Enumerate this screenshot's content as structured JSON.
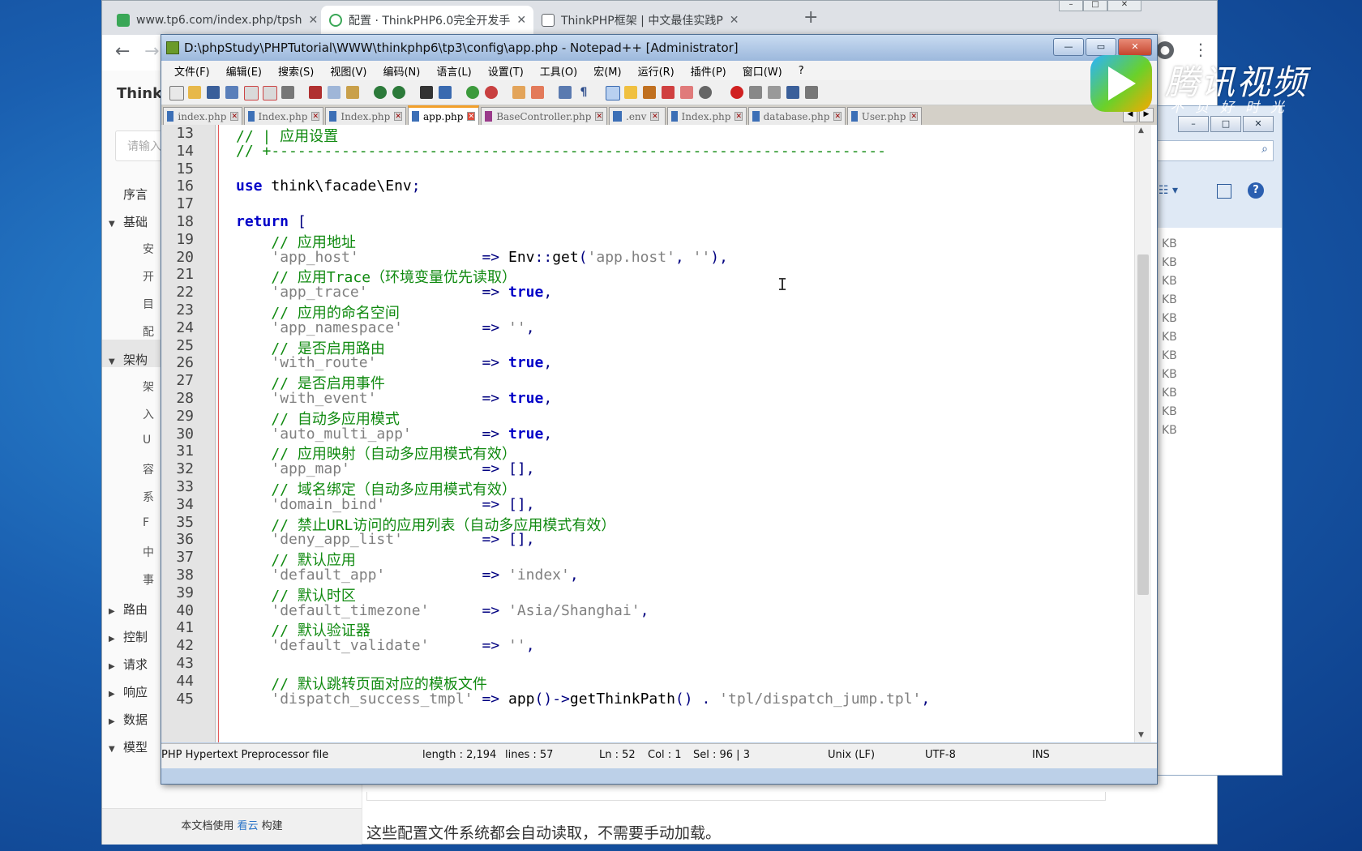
{
  "browser": {
    "tabs": [
      {
        "label": "www.tp6.com/index.php/tpsh",
        "active": false
      },
      {
        "label": "配置 · ThinkPHP6.0完全开发手",
        "active": true
      },
      {
        "label": "ThinkPHP框架 | 中文最佳实践P",
        "active": false
      }
    ],
    "new_tab": "+",
    "back": "←",
    "forward": "→"
  },
  "doc": {
    "brand": "ThinkP",
    "search_placeholder": "请输入",
    "nav": [
      {
        "label": "序言",
        "expandable": false
      },
      {
        "label": "基础",
        "expandable": true,
        "open": true
      },
      {
        "label": "架构",
        "expandable": true,
        "open": true
      },
      {
        "label": "路由",
        "expandable": true,
        "open": false
      },
      {
        "label": "控制",
        "expandable": true,
        "open": false
      },
      {
        "label": "请求",
        "expandable": true,
        "open": false
      },
      {
        "label": "响应",
        "expandable": true,
        "open": false
      },
      {
        "label": "数据",
        "expandable": true,
        "open": false
      },
      {
        "label": "模型",
        "expandable": true,
        "open": true
      }
    ],
    "sub_basic": [
      "安",
      "开",
      "目",
      "配"
    ],
    "sub_arch": [
      "架",
      "入",
      "U",
      "容",
      "系",
      "F",
      "中",
      "事"
    ],
    "footer_prefix": "本文档使用",
    "footer_link": "看云",
    "footer_suffix": "构建",
    "paragraph": "这些配置文件系统都会自动读取，不需要手动加载。"
  },
  "explorer": {
    "sizes": [
      "KB",
      "KB",
      "KB",
      "KB",
      "KB",
      "KB",
      "KB",
      "KB",
      "KB",
      "KB",
      "KB"
    ]
  },
  "npp": {
    "title": "D:\\phpStudy\\PHPTutorial\\WWW\\thinkphp6\\tp3\\config\\app.php - Notepad++ [Administrator]",
    "menu": [
      "文件(F)",
      "编辑(E)",
      "搜索(S)",
      "视图(V)",
      "编码(N)",
      "语言(L)",
      "设置(T)",
      "工具(O)",
      "宏(M)",
      "运行(R)",
      "插件(P)",
      "窗口(W)",
      "?"
    ],
    "tabs": [
      {
        "label": "index.php",
        "active": false
      },
      {
        "label": "Index.php",
        "active": false
      },
      {
        "label": "Index.php",
        "active": false
      },
      {
        "label": "app.php",
        "active": true
      },
      {
        "label": "BaseController.php",
        "active": false
      },
      {
        "label": ".env",
        "active": false
      },
      {
        "label": "Index.php",
        "active": false
      },
      {
        "label": "database.php",
        "active": false
      },
      {
        "label": "User.php",
        "active": false
      }
    ],
    "line_numbers": [
      "13",
      "14",
      "15",
      "16",
      "17",
      "18",
      "19",
      "20",
      "21",
      "22",
      "23",
      "24",
      "25",
      "26",
      "27",
      "28",
      "29",
      "30",
      "31",
      "32",
      "33",
      "34",
      "35",
      "36",
      "37",
      "38",
      "39",
      "40",
      "41",
      "42",
      "43",
      "44",
      "45"
    ],
    "code": [
      "// | 应用设置",
      "// +----------------------------------------------------------------------",
      "",
      "use think\\facade\\Env;",
      "",
      "return [",
      "    // 应用地址",
      "    'app_host'              => Env::get('app.host', ''),",
      "    // 应用Trace（环境变量优先读取）",
      "    'app_trace'             => true,",
      "    // 应用的命名空间",
      "    'app_namespace'         => '',",
      "    // 是否启用路由",
      "    'with_route'            => true,",
      "    // 是否启用事件",
      "    'with_event'            => true,",
      "    // 自动多应用模式",
      "    'auto_multi_app'        => true,",
      "    // 应用映射（自动多应用模式有效）",
      "    'app_map'               => [],",
      "    // 域名绑定（自动多应用模式有效）",
      "    'domain_bind'           => [],",
      "    // 禁止URL访问的应用列表（自动多应用模式有效）",
      "    'deny_app_list'         => [],",
      "    // 默认应用",
      "    'default_app'           => 'index',",
      "    // 默认时区",
      "    'default_timezone'      => 'Asia/Shanghai',",
      "    // 默认验证器",
      "    'default_validate'      => '',",
      "",
      "    // 默认跳转页面对应的模板文件",
      "    'dispatch_success_tmpl' => app()->getThinkPath() . 'tpl/dispatch_jump.tpl',"
    ],
    "status": {
      "filetype": "PHP Hypertext Preprocessor file",
      "length": "length : 2,194",
      "lines": "lines : 57",
      "ln": "Ln : 52",
      "col": "Col : 1",
      "sel": "Sel : 96 | 3",
      "eol": "Unix (LF)",
      "encoding": "UTF-8",
      "mode": "INS"
    }
  },
  "watermark": {
    "name": "腾讯视频",
    "slogan": "不负好时光"
  }
}
